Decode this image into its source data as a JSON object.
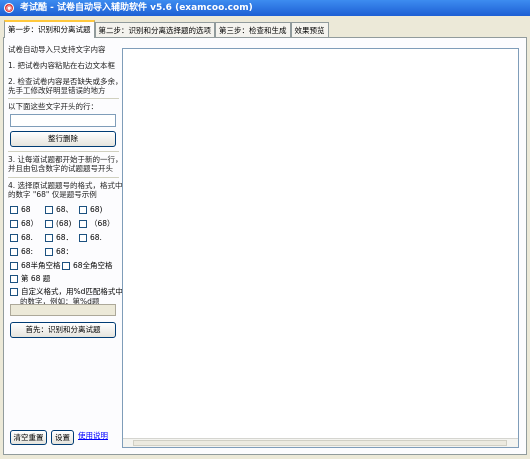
{
  "window": {
    "title": "考试酷 - 试卷自动导入辅助软件 v5.6 (examcoo.com)"
  },
  "tabs": [
    "第一步：识别和分离试题",
    "第二步：识别和分离选择题的选项",
    "第三步：检查和生成",
    "效果预览"
  ],
  "left": {
    "heading": "试卷自动导入只支持文字内容",
    "step1": "1. 把试卷内容粘贴在右边文本框",
    "step2_l1": "2. 检查试卷内容是否缺失或多余，",
    "step2_l2": "先手工修改好明显错误的地方",
    "delete_label": "以下面这些文字开头的行：",
    "delete_input_value": "",
    "delete_button": "整行删除",
    "step3_l1": "3. 让每道试题都开始于新的一行，",
    "step3_l2": "并且由包含数字的试题题号开头",
    "step4_l1": "4. 选择原试题题号的格式，格式中",
    "step4_l2": "的数字 \"68\" 仅是题号示例",
    "formats": [
      [
        "68",
        "68、",
        "68)"
      ],
      [
        "68）",
        "(68)",
        "（68）"
      ],
      [
        "68.",
        "68．",
        "68."
      ],
      [
        "68:",
        "68："
      ]
    ],
    "half_space": "68半角空格",
    "full_space": "68全角空格",
    "di_ti": "第 68 题",
    "custom_l1": "自定义格式，用%d匹配格式中",
    "custom_l2": "的数字，例如：第%d题",
    "custom_value": "",
    "recognize_button": "首先：识别和分离试题",
    "reset_button": "清空重置",
    "settings_button": "设置",
    "help_link": "使用说明"
  },
  "editor": {
    "content": ""
  }
}
